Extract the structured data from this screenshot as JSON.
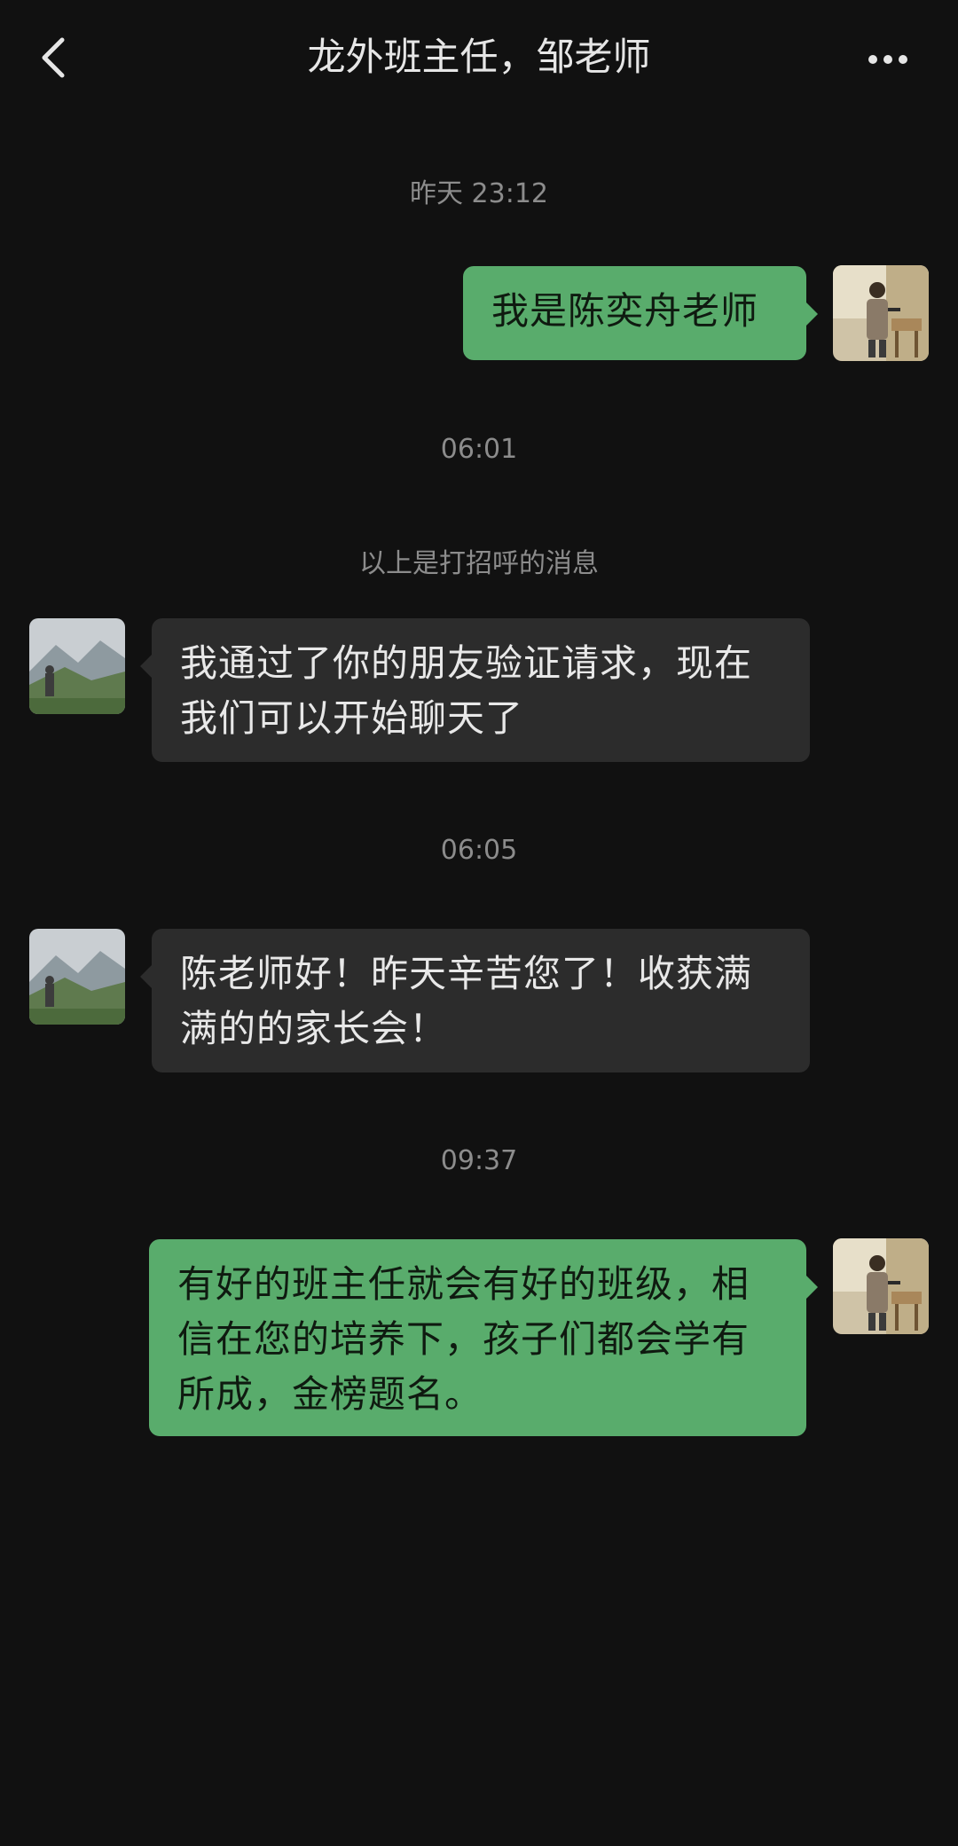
{
  "header": {
    "title": "龙外班主任，邹老师",
    "back_icon": "chevron-left-icon",
    "more_icon": "more-dots-icon"
  },
  "timestamps": {
    "t1": "昨天 23:12",
    "t2": "06:01",
    "t3": "06:05",
    "t4": "09:37"
  },
  "system_note": "以上是打招呼的消息",
  "messages": [
    {
      "side": "outgoing",
      "text": "我是陈奕舟老师"
    },
    {
      "side": "incoming",
      "text": "我通过了你的朋友验证请求，现在我们可以开始聊天了"
    },
    {
      "side": "incoming",
      "text": "陈老师好！昨天辛苦您了！收获满满的的家长会！"
    },
    {
      "side": "outgoing",
      "text": "有好的班主任就会有好的班级，相信在您的培养下，孩子们都会学有所成，金榜题名。"
    }
  ],
  "colors": {
    "background": "#111111",
    "outgoing_bubble": "#59ac6c",
    "incoming_bubble": "#2c2c2c",
    "timestamp_text": "#8c8c8c"
  }
}
